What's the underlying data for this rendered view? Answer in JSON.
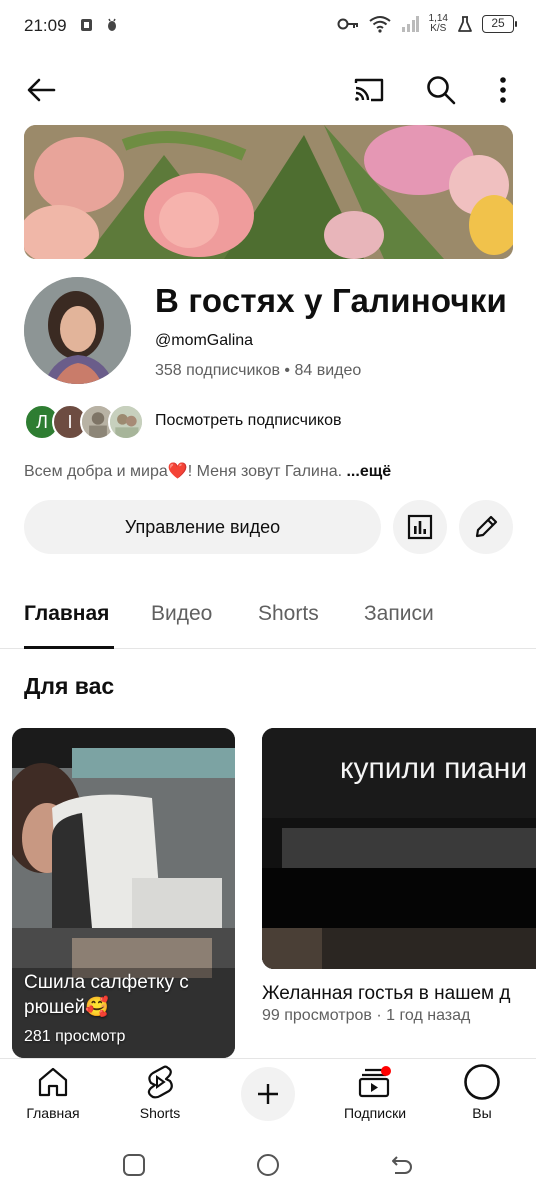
{
  "status": {
    "time": "21:09",
    "speed_value": "1,14",
    "speed_unit": "K/S",
    "battery": "25"
  },
  "icons": {
    "back": "arrow-left-icon",
    "cast": "cast-icon",
    "search": "search-icon",
    "more": "more-vertical-icon",
    "analytics": "bar-chart-icon",
    "edit": "pencil-icon"
  },
  "channel": {
    "name": "В гостях у Галиночки",
    "handle": "@momGalina",
    "subscribers": "358 подписчиков",
    "videos": "84 видео",
    "view_subscribers": "Посмотреть подписчиков",
    "subscriber_initials": [
      "Л",
      "I"
    ],
    "description": "Всем добра и мира❤️! Меня зовут Галина. ",
    "more": "...ещё"
  },
  "actions": {
    "manage_videos": "Управление видео"
  },
  "tabs": [
    {
      "label": "Главная",
      "active": true
    },
    {
      "label": "Видео",
      "active": false
    },
    {
      "label": "Shorts",
      "active": false
    },
    {
      "label": "Записи",
      "active": false
    }
  ],
  "section": {
    "title": "Для вас"
  },
  "cards": [
    {
      "title": "Сшила салфетку с рюшей🥰",
      "views": "281 просмотр"
    },
    {
      "overlay_text": "купили пиани",
      "title": "Желанная гостья в нашем д",
      "meta": "99 просмотров · 1 год назад"
    }
  ],
  "bottom_nav": [
    {
      "label": "Главная",
      "icon": "home-icon"
    },
    {
      "label": "Shorts",
      "icon": "shorts-icon"
    },
    {
      "label": "",
      "icon": "plus-icon"
    },
    {
      "label": "Подписки",
      "icon": "subscriptions-icon"
    },
    {
      "label": "Вы",
      "icon": "profile-icon"
    }
  ],
  "colors": {
    "accent_red": "#ff0000",
    "button_bg": "#f2f2f2",
    "secondary_text": "#606060"
  }
}
